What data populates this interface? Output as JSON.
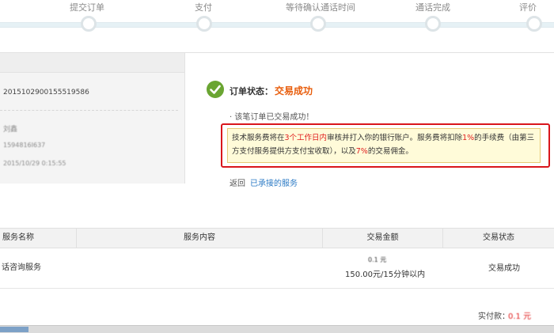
{
  "steps": [
    {
      "label": "提交订单"
    },
    {
      "label": "支付"
    },
    {
      "label": "等待确认通话时间"
    },
    {
      "label": "通话完成"
    },
    {
      "label": "评价"
    }
  ],
  "order": {
    "number": "2015102900155519586",
    "contact_name": "刘鑫",
    "phone": "1594816I637",
    "time": "2015/10/29 0:15:55"
  },
  "status": {
    "label": "订单状态：",
    "value": "交易成功",
    "message": "· 该笔订单已交易成功！"
  },
  "notice": {
    "p1": "技术服务费将在",
    "p1_hl": "3个工作日内",
    "p2": "审核并打入你的银行账户。服务费将扣除",
    "p2_hl": "1%",
    "p3": "的手续费（由第三方支付服务提供方支付宝收取），以及",
    "p3_hl": "7%",
    "p4": "的交易佣金。"
  },
  "back": {
    "prefix": "返回",
    "link": "已承接的服务"
  },
  "table": {
    "headers": [
      "服务名称",
      "服务内容",
      "交易金额",
      "交易状态"
    ],
    "row": {
      "name": "话咨询服务",
      "content": "",
      "amount_top": "0.1 元",
      "amount": "150.00元/15分钟以内",
      "status": "交易成功"
    }
  },
  "footer": {
    "paid_label": "实付款：",
    "paid_value": "0.1 元"
  },
  "colors": {
    "accent_orange": "#e85d0c",
    "alert_red": "#d9161c",
    "link_blue": "#2a79c4",
    "success_green": "#6aa532"
  }
}
